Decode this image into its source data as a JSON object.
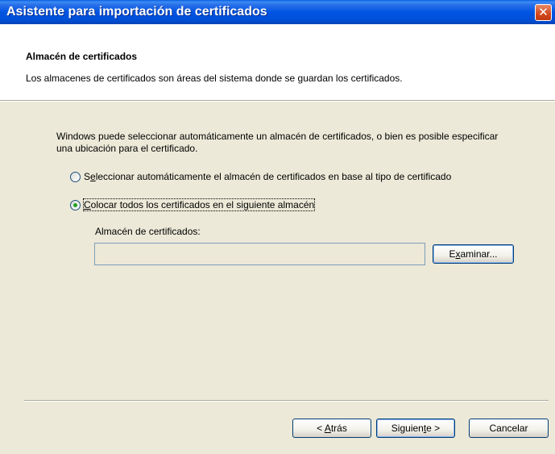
{
  "window": {
    "title": "Asistente para importación de certificados",
    "close_symbol": "✕"
  },
  "header": {
    "title": "Almacén de certificados",
    "subtitle": "Los almacenes de certificados son áreas del sistema donde se guardan los certificados."
  },
  "body": {
    "description": "Windows puede seleccionar automáticamente un almacén de certificados, o bien es posible especificar una ubicación para el certificado.",
    "options": [
      {
        "pre": "S",
        "mnemonic": "e",
        "post": "leccionar automáticamente el almacén de certificados en base al tipo de certificado",
        "selected": false
      },
      {
        "pre": "",
        "mnemonic": "C",
        "post": "olocar todos los certificados en el siguiente almacén",
        "selected": true
      }
    ],
    "store_label": "Almacén de certificados:",
    "store_value": "",
    "browse": {
      "pre": "E",
      "mnemonic": "x",
      "post": "aminar..."
    }
  },
  "footer": {
    "back": {
      "pre": "< ",
      "mnemonic": "A",
      "post": "trás"
    },
    "next": {
      "pre": "Siguien",
      "mnemonic": "t",
      "post": "e >"
    },
    "cancel": "Cancelar"
  },
  "colors": {
    "titlebar": "#0054e3",
    "dialog_bg": "#ece9d8",
    "header_bg": "#ffffff",
    "radio_dot": "#21a121"
  }
}
